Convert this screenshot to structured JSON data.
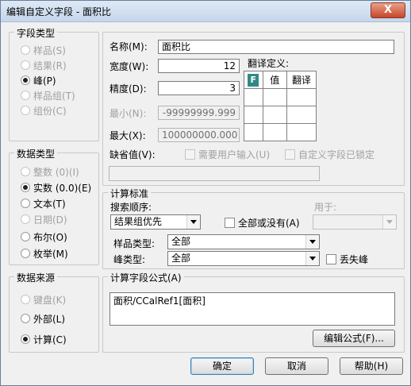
{
  "window": {
    "title": "编辑自定义字段 - 面积比",
    "close_glyph": "X"
  },
  "field_type": {
    "legend": "字段类型",
    "options": [
      {
        "label": "样品(S)",
        "checked": false,
        "enabled": false
      },
      {
        "label": "结果(R)",
        "checked": false,
        "enabled": false
      },
      {
        "label": "峰(P)",
        "checked": true,
        "enabled": true
      },
      {
        "label": "样品组(T)",
        "checked": false,
        "enabled": false
      },
      {
        "label": "组份(C)",
        "checked": false,
        "enabled": false
      }
    ]
  },
  "data_type": {
    "legend": "数据类型",
    "options": [
      {
        "label": "整数 (0)(I)",
        "checked": false,
        "enabled": false
      },
      {
        "label": "实数 (0.0)(E)",
        "checked": true,
        "enabled": true
      },
      {
        "label": "文本(T)",
        "checked": false,
        "enabled": true
      },
      {
        "label": "日期(D)",
        "checked": false,
        "enabled": false
      },
      {
        "label": "布尔(O)",
        "checked": false,
        "enabled": true
      },
      {
        "label": "枚举(M)",
        "checked": false,
        "enabled": true
      }
    ]
  },
  "data_source": {
    "legend": "数据来源",
    "options": [
      {
        "label": "键盘(K)",
        "checked": false,
        "enabled": false
      },
      {
        "label": "外部(L)",
        "checked": false,
        "enabled": true
      },
      {
        "label": "计算(C)",
        "checked": true,
        "enabled": true
      }
    ]
  },
  "properties": {
    "name_label": "名称(M):",
    "name_value": "面积比",
    "width_label": "宽度(W):",
    "width_value": "12",
    "precision_label": "精度(D):",
    "precision_value": "3",
    "min_label": "最小(N):",
    "min_value": "-99999999.999",
    "max_label": "最大(X):",
    "max_value": "100000000.000",
    "translation_label": "翻译定义:",
    "translation_col_value": "值",
    "translation_col_translate": "翻译",
    "default_label": "缺省值(V):",
    "default_value": "",
    "require_input_label": "需要用户输入(U)",
    "locked_label": "自定义字段已锁定"
  },
  "calc_criteria": {
    "legend": "计算标准",
    "search_order_label": "搜索顺序:",
    "search_order_value": "结果组优先",
    "all_or_none_label": "全部或没有(A)",
    "used_for_label": "用于:",
    "used_for_value": "",
    "sample_type_label": "样品类型:",
    "sample_type_value": "全部",
    "peak_type_label": "峰类型:",
    "peak_type_value": "全部",
    "missing_peak_label": "丢失峰"
  },
  "formula": {
    "legend": "计算字段公式(A)",
    "value": "面积/CCalRef1[面积]",
    "edit_button": "编辑公式(F)..."
  },
  "buttons": {
    "ok": "确定",
    "cancel": "取消",
    "help": "帮助(H)"
  }
}
